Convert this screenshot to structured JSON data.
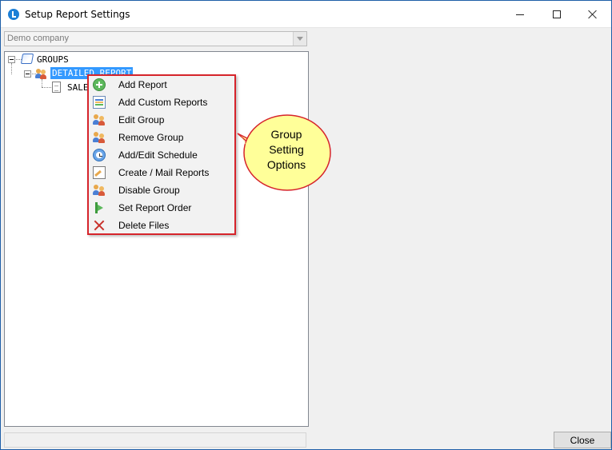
{
  "window": {
    "title": "Setup Report Settings"
  },
  "company_select": {
    "value": "Demo company"
  },
  "tree": {
    "root_label": "GROUPS",
    "group_label": "DETAILED REPORT",
    "child_label": "SALE"
  },
  "context_menu": {
    "items": [
      {
        "label": "Add Report",
        "icon": "add-icon"
      },
      {
        "label": "Add Custom Reports",
        "icon": "custom-reports-icon"
      },
      {
        "label": "Edit Group",
        "icon": "edit-group-icon"
      },
      {
        "label": "Remove Group",
        "icon": "remove-group-icon"
      },
      {
        "label": "Add/Edit Schedule",
        "icon": "schedule-icon"
      },
      {
        "label": "Create / Mail Reports",
        "icon": "mail-reports-icon"
      },
      {
        "label": "Disable Group",
        "icon": "disable-group-icon"
      },
      {
        "label": "Set Report Order",
        "icon": "report-order-icon"
      },
      {
        "label": "Delete Files",
        "icon": "delete-icon"
      }
    ]
  },
  "callout": {
    "lines": [
      "Group",
      "Setting",
      "Options"
    ],
    "fill_color": "#ffff99",
    "border_color": "#d6242b"
  },
  "footer": {
    "close_label": "Close"
  },
  "colors": {
    "selection": "#3399ff",
    "menu_border": "#d6242b",
    "window_border": "#1e5fa8"
  }
}
